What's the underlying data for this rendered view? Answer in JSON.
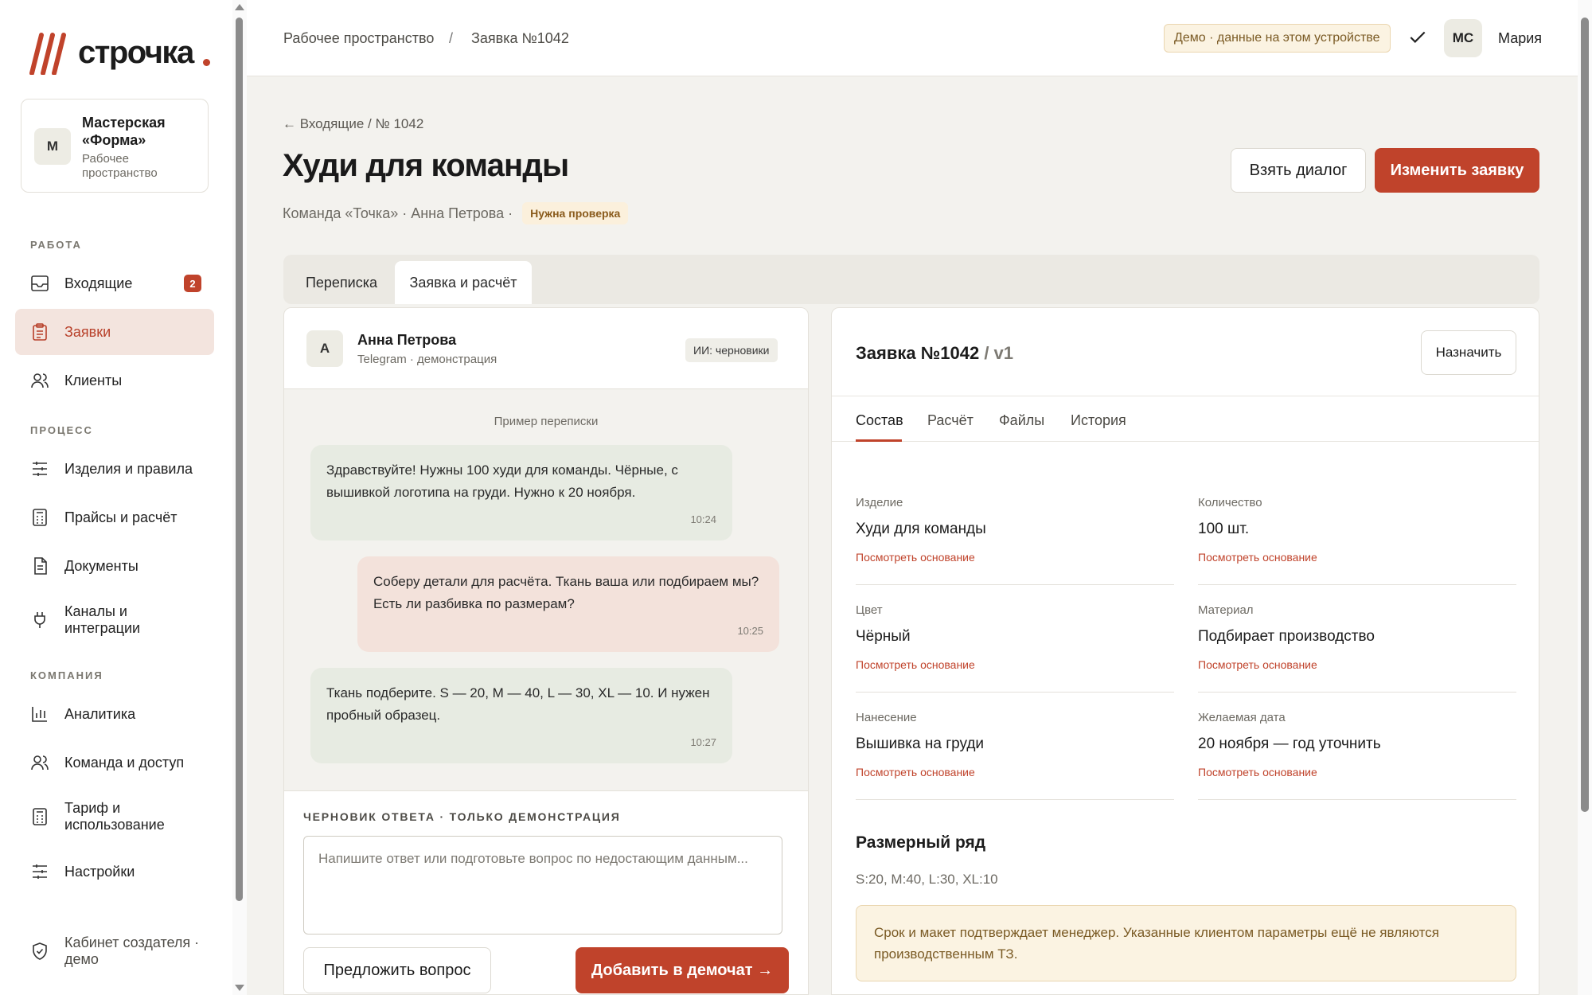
{
  "brand": {
    "name": "строчка",
    "accent": "#c0432b"
  },
  "workspace": {
    "avatar": "М",
    "name": "Мастерская «Форма»",
    "subtitle": "Рабочее пространство"
  },
  "sidebar": {
    "sections": [
      {
        "label": "РАБОТА"
      },
      {
        "label": "ПРОЦЕСС"
      },
      {
        "label": "КОМПАНИЯ"
      }
    ],
    "items": [
      {
        "label": "Входящие",
        "icon": "inbox-icon",
        "badge": "2"
      },
      {
        "label": "Заявки",
        "icon": "clipboard-icon",
        "active": true
      },
      {
        "label": "Клиенты",
        "icon": "users-icon"
      },
      {
        "label": "Изделия и правила",
        "icon": "sliders-icon"
      },
      {
        "label": "Прайсы и расчёт",
        "icon": "calculator-icon"
      },
      {
        "label": "Документы",
        "icon": "document-icon"
      },
      {
        "label": "Каналы и интеграции",
        "icon": "plug-icon"
      },
      {
        "label": "Аналитика",
        "icon": "chart-icon"
      },
      {
        "label": "Команда и доступ",
        "icon": "team-icon"
      },
      {
        "label": "Тариф и использование",
        "icon": "receipt-icon"
      },
      {
        "label": "Настройки",
        "icon": "settings-icon"
      },
      {
        "label": "Кабинет создателя · демо",
        "icon": "shield-icon"
      }
    ]
  },
  "topbar": {
    "breadcrumb": [
      "Рабочее пространство",
      "/",
      "Заявка №1042"
    ],
    "demo_badge": "Демо · данные на этом устройстве",
    "user_initials": "МС",
    "user_name": "Мария"
  },
  "page": {
    "back": "← Входящие / № 1042",
    "title": "Худи для команды",
    "meta": "Команда «Точка» · Анна Петрова ·",
    "status_badge": "Нужна проверка",
    "take_dialog": "Взять диалог",
    "edit_order": "Изменить заявку",
    "tabs": [
      "Переписка",
      "Заявка и расчёт"
    ]
  },
  "chat": {
    "avatar": "А",
    "name": "Анна Петрова",
    "channel": "Telegram · демонстрация",
    "ai_badge": "ИИ: черновики",
    "sample_label": "Пример переписки",
    "messages": [
      {
        "dir": "in",
        "text": "Здравствуйте! Нужны 100 худи для команды. Чёрные, с вышивкой логотипа на груди. Нужно к 20 ноября.",
        "time": "10:24"
      },
      {
        "dir": "out",
        "text": "Соберу детали для расчёта. Ткань ваша или подбираем мы? Есть ли разбивка по размерам?",
        "time": "10:25"
      },
      {
        "dir": "in",
        "text": "Ткань подберите. S — 20, M — 40, L — 30, XL — 10. И нужен пробный образец.",
        "time": "10:27"
      }
    ],
    "draft_label": "ЧЕРНОВИК ОТВЕТА · ТОЛЬКО ДЕМОНСТРАЦИЯ",
    "draft_placeholder": "Напишите ответ или подготовьте вопрос по недостающим данным...",
    "suggest_button": "Предложить вопрос",
    "add_button": "Добавить в демочат →"
  },
  "order": {
    "title": "Заявка №1042",
    "version": " / v1",
    "assign": "Назначить",
    "tabs": [
      "Состав",
      "Расчёт",
      "Файлы",
      "История"
    ],
    "fields": [
      {
        "label": "Изделие",
        "value": "Худи для команды",
        "link": "Посмотреть основание"
      },
      {
        "label": "Количество",
        "value": "100 шт.",
        "link": "Посмотреть основание"
      },
      {
        "label": "Цвет",
        "value": "Чёрный",
        "link": "Посмотреть основание"
      },
      {
        "label": "Материал",
        "value": "Подбирает производство",
        "link": "Посмотреть основание"
      },
      {
        "label": "Нанесение",
        "value": "Вышивка на груди",
        "link": "Посмотреть основание"
      },
      {
        "label": "Желаемая дата",
        "value": "20 ноября — год уточнить",
        "link": "Посмотреть основание"
      }
    ],
    "size_title": "Размерный ряд",
    "size_value": "S:20, M:40, L:30, XL:10",
    "note": "Срок и макет подтверждает менеджер. Указанные клиентом параметры ещё не являются производственным ТЗ."
  }
}
